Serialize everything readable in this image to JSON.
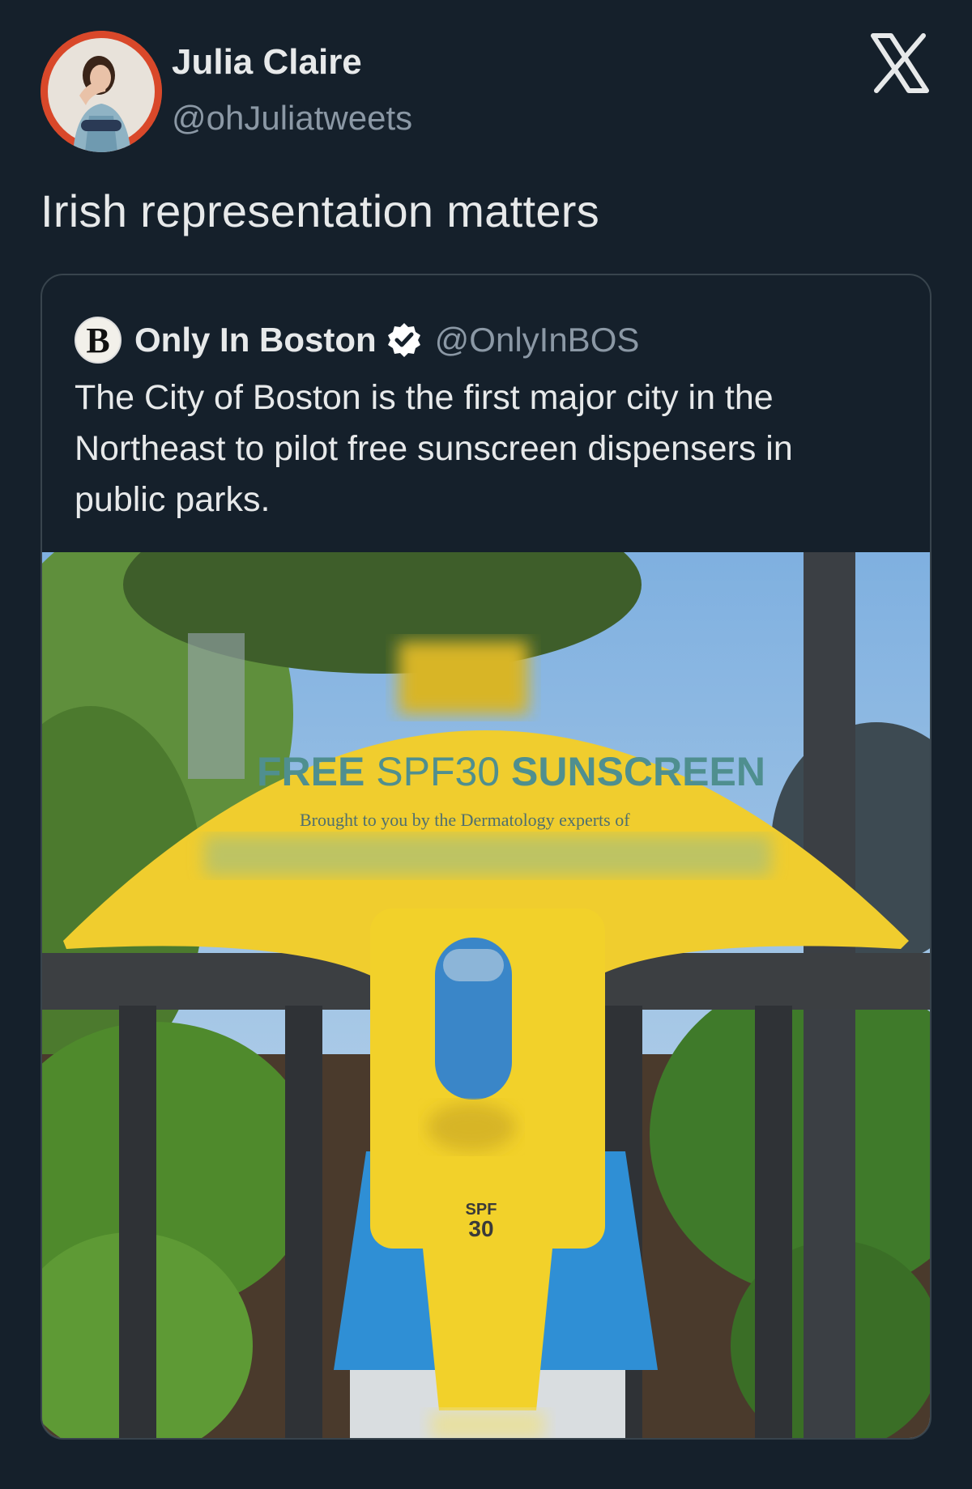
{
  "author": {
    "name": "Julia Claire",
    "handle": "@ohJuliatweets",
    "avatar_icon": "profile-photo"
  },
  "platform_icon": "x-logo-icon",
  "tweet": {
    "text": "Irish representation matters"
  },
  "quoted_post": {
    "avatar_letter": "B",
    "name": "Only In Boston",
    "verified": true,
    "handle": "@OnlyInBOS",
    "text": "The City of Boston is the first major city in the Northeast to pilot free sunscreen dispensers in public parks.",
    "image": {
      "sign_title_part1": "FREE ",
      "sign_title_part2": "SPF30 ",
      "sign_title_part3": "SUNSCREEN",
      "sign_subtitle": "Brought to you by the Dermatology experts of",
      "dispenser_label_top": "SPF",
      "dispenser_label_bottom": "30"
    }
  },
  "colors": {
    "background": "#15202b",
    "text": "#e7e9ea",
    "secondary_text": "#8b98a5",
    "border": "#38444d",
    "sign_yellow": "#f0cd2e",
    "sign_text": "#4f8f8f"
  }
}
